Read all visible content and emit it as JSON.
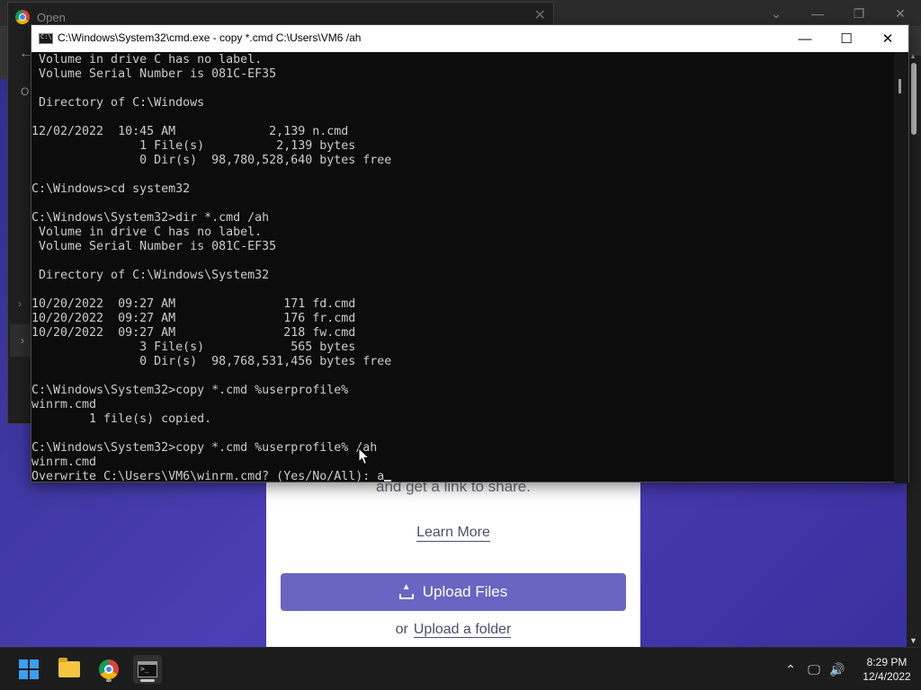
{
  "chrome": {
    "dialog_title": "Open",
    "sidebar_letter": "O"
  },
  "cmd": {
    "title": "C:\\Windows\\System32\\cmd.exe - copy  *.cmd C:\\Users\\VM6 /ah",
    "lines": [
      " Volume in drive C has no label.",
      " Volume Serial Number is 081C-EF35",
      "",
      " Directory of C:\\Windows",
      "",
      "12/02/2022  10:45 AM             2,139 n.cmd",
      "               1 File(s)          2,139 bytes",
      "               0 Dir(s)  98,780,528,640 bytes free",
      "",
      "C:\\Windows>cd system32",
      "",
      "C:\\Windows\\System32>dir *.cmd /ah",
      " Volume in drive C has no label.",
      " Volume Serial Number is 081C-EF35",
      "",
      " Directory of C:\\Windows\\System32",
      "",
      "10/20/2022  09:27 AM               171 fd.cmd",
      "10/20/2022  09:27 AM               176 fr.cmd",
      "10/20/2022  09:27 AM               218 fw.cmd",
      "               3 File(s)            565 bytes",
      "               0 Dir(s)  98,768,531,456 bytes free",
      "",
      "C:\\Windows\\System32>copy *.cmd %userprofile%",
      "winrm.cmd",
      "        1 file(s) copied.",
      "",
      "C:\\Windows\\System32>copy *.cmd %userprofile% /ah",
      "winrm.cmd"
    ],
    "prompt_line": "Overwrite C:\\Users\\VM6\\winrm.cmd? (Yes/No/All): a"
  },
  "upload": {
    "subtitle": "and get a link to share.",
    "learn_more": "Learn More",
    "upload_files": "Upload Files",
    "or_text": "or",
    "upload_folder": "Upload a folder"
  },
  "taskbar": {
    "time": "8:29 PM",
    "date": "12/4/2022"
  },
  "colors": {
    "page_purple": "#4b3fb5",
    "upload_button": "#6a64c2",
    "console_bg": "#0c0c0c",
    "console_text": "#cccccc"
  }
}
